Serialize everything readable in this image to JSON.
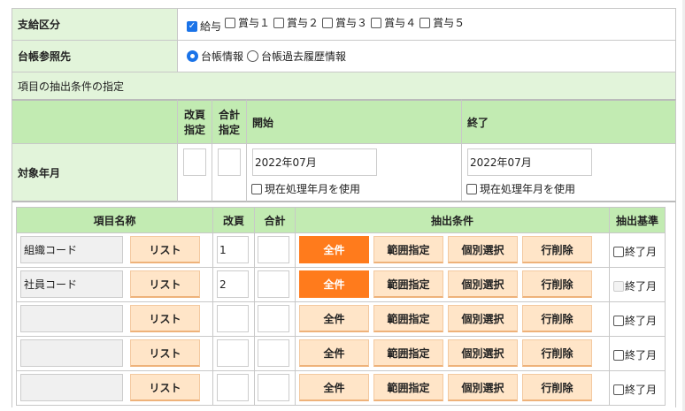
{
  "pay_type": {
    "label": "支給区分",
    "options": [
      {
        "label": "給与",
        "checked": true
      },
      {
        "label": "賞与１",
        "checked": false
      },
      {
        "label": "賞与２",
        "checked": false
      },
      {
        "label": "賞与３",
        "checked": false
      },
      {
        "label": "賞与４",
        "checked": false
      },
      {
        "label": "賞与５",
        "checked": false
      }
    ]
  },
  "ledger": {
    "label": "台帳参照先",
    "options": [
      {
        "label": "台帳情報",
        "selected": true
      },
      {
        "label": "台帳過去履歴情報",
        "selected": false
      }
    ]
  },
  "section_title": "項目の抽出条件の指定",
  "period": {
    "headers": {
      "page_break": "改頁",
      "page_break2": "指定",
      "total": "合計",
      "total2": "指定",
      "start": "開始",
      "end": "終了"
    },
    "label": "対象年月",
    "start_value": "2022年07月",
    "end_value": "2022年07月",
    "use_current": "現在処理年月を使用"
  },
  "items": {
    "headers": {
      "name": "項目名称",
      "page_break": "改頁",
      "total": "合計",
      "condition": "抽出条件",
      "basis": "抽出基準"
    },
    "buttons": {
      "list": "リスト",
      "all": "全件",
      "range": "範囲指定",
      "select": "個別選択",
      "delete": "行削除"
    },
    "basis_label": "終了月",
    "rows": [
      {
        "name": "組織コード",
        "page_break": "1",
        "total": "",
        "all_active": true,
        "basis_disabled": false
      },
      {
        "name": "社員コード",
        "page_break": "2",
        "total": "",
        "all_active": true,
        "basis_disabled": true
      },
      {
        "name": "",
        "page_break": "",
        "total": "",
        "all_active": false,
        "basis_disabled": false
      },
      {
        "name": "",
        "page_break": "",
        "total": "",
        "all_active": false,
        "basis_disabled": false
      },
      {
        "name": "",
        "page_break": "",
        "total": "",
        "all_active": false,
        "basis_disabled": false
      }
    ]
  }
}
